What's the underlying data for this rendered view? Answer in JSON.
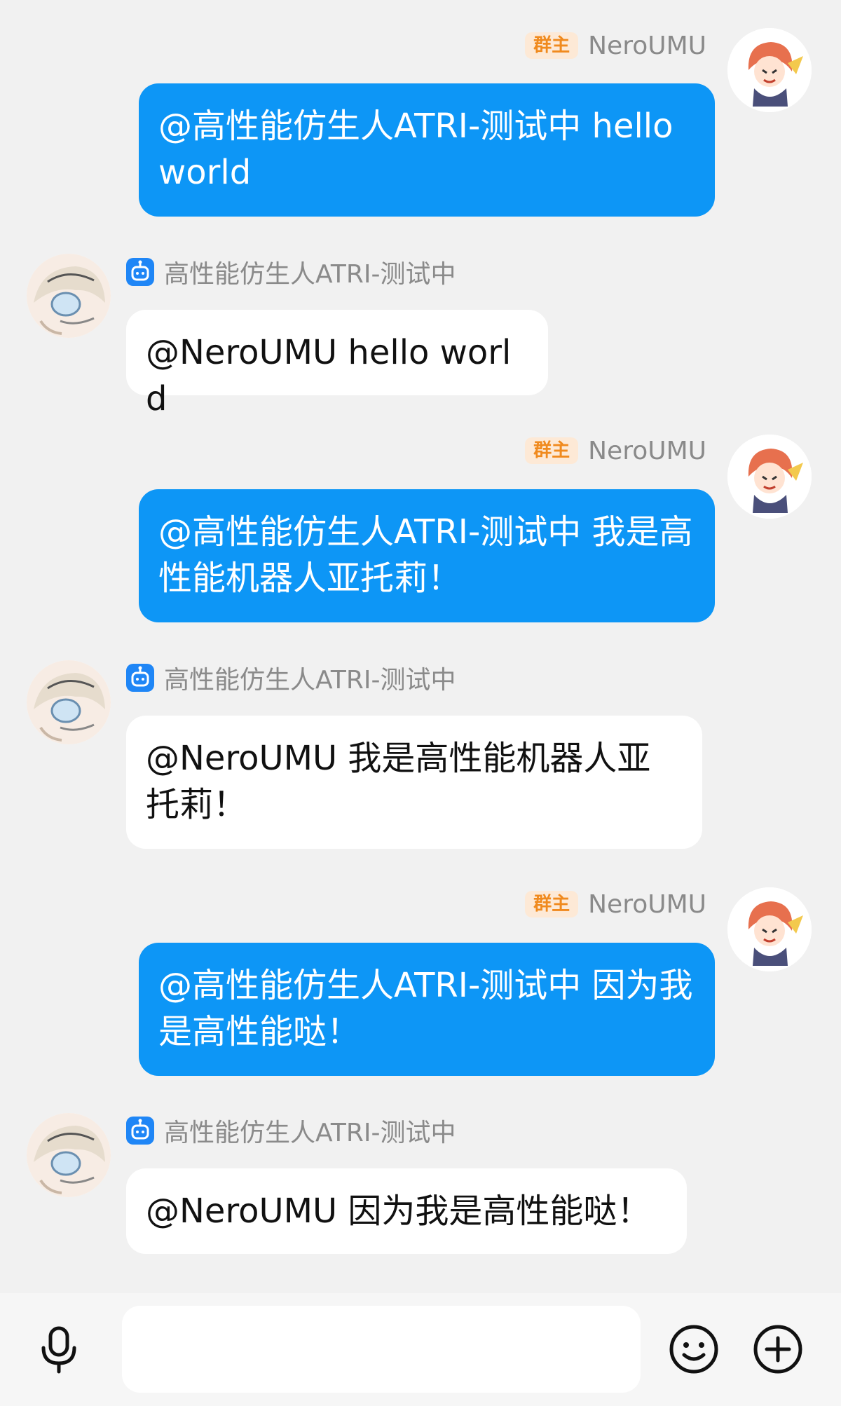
{
  "messages": [
    {
      "direction": "out",
      "sender_name": "NeroUMU",
      "role_badge": "群主",
      "text": "@高性能仿生人ATRI-测试中 hello world"
    },
    {
      "direction": "in",
      "sender_name": "高性能仿生人ATRI-测试中",
      "text": "@NeroUMU hello world"
    },
    {
      "direction": "out",
      "sender_name": "NeroUMU",
      "role_badge": "群主",
      "text": "@高性能仿生人ATRI-测试中 我是高性能机器人亚托莉！"
    },
    {
      "direction": "in",
      "sender_name": "高性能仿生人ATRI-测试中",
      "text": "@NeroUMU 我是高性能机器人亚托莉！"
    },
    {
      "direction": "out",
      "sender_name": "NeroUMU",
      "role_badge": "群主",
      "text": "@高性能仿生人ATRI-测试中 因为我是高性能哒！"
    },
    {
      "direction": "in",
      "sender_name": "高性能仿生人ATRI-测试中",
      "text": "@NeroUMU 因为我是高性能哒！"
    }
  ],
  "input_bar": {
    "voice_icon": "microphone-icon",
    "emoji_icon": "smiley-icon",
    "more_icon": "plus-circle-icon",
    "text_value": ""
  },
  "colors": {
    "background": "#f1f1f1",
    "outgoing_bubble": "#0d96f6",
    "incoming_bubble": "#ffffff",
    "owner_badge_bg": "#fde9d6",
    "owner_badge_text": "#f08a1e",
    "bot_badge": "#1f86f6"
  }
}
